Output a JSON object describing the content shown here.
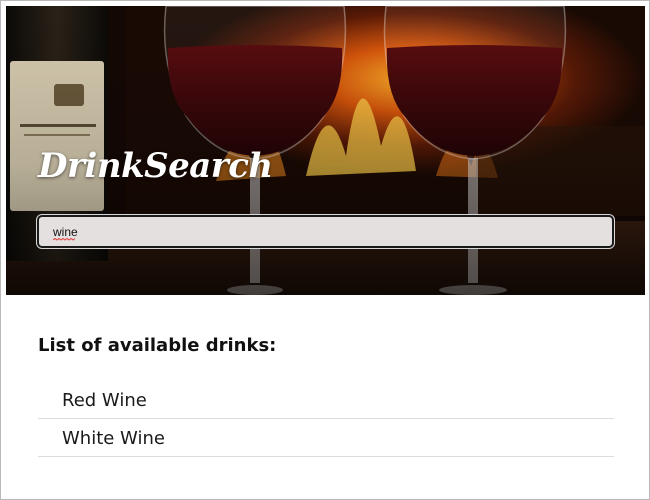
{
  "app": {
    "title": "DrinkSearch"
  },
  "search": {
    "value": "wine",
    "placeholder": ""
  },
  "list": {
    "heading": "List of available drinks:",
    "items": [
      {
        "label": "Red Wine"
      },
      {
        "label": "White Wine"
      }
    ]
  },
  "colors": {
    "hero_background": "#140804",
    "search_background": "#e4e0df",
    "search_border": "#1a1a1a",
    "title_text": "#ffffff",
    "list_divider": "#dcdcdc",
    "spellcheck_underline": "#e23a3a"
  }
}
